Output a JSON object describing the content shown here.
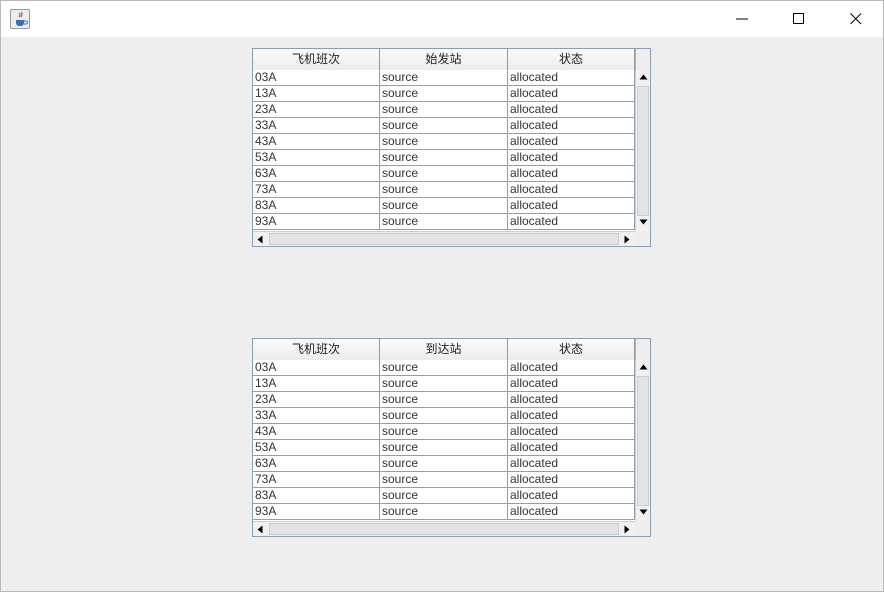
{
  "window": {
    "icon": "java-cup-icon",
    "controls": [
      "minimize-icon",
      "maximize-icon",
      "close-icon"
    ]
  },
  "departure_table": {
    "columns": [
      "飞机班次",
      "始发站",
      "状态"
    ],
    "rows": [
      [
        "03A",
        "source",
        "allocated"
      ],
      [
        "13A",
        "source",
        "allocated"
      ],
      [
        "23A",
        "source",
        "allocated"
      ],
      [
        "33A",
        "source",
        "allocated"
      ],
      [
        "43A",
        "source",
        "allocated"
      ],
      [
        "53A",
        "source",
        "allocated"
      ],
      [
        "63A",
        "source",
        "allocated"
      ],
      [
        "73A",
        "source",
        "allocated"
      ],
      [
        "83A",
        "source",
        "allocated"
      ],
      [
        "93A",
        "source",
        "allocated"
      ]
    ]
  },
  "arrival_table": {
    "columns": [
      "飞机班次",
      "到达站",
      "状态"
    ],
    "rows": [
      [
        "03A",
        "source",
        "allocated"
      ],
      [
        "13A",
        "source",
        "allocated"
      ],
      [
        "23A",
        "source",
        "allocated"
      ],
      [
        "33A",
        "source",
        "allocated"
      ],
      [
        "43A",
        "source",
        "allocated"
      ],
      [
        "53A",
        "source",
        "allocated"
      ],
      [
        "63A",
        "source",
        "allocated"
      ],
      [
        "73A",
        "source",
        "allocated"
      ],
      [
        "83A",
        "source",
        "allocated"
      ],
      [
        "93A",
        "source",
        "allocated"
      ]
    ]
  }
}
